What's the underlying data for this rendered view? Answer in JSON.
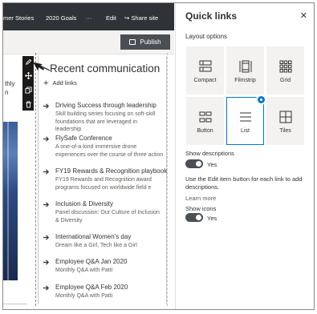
{
  "topbar": {
    "items": [
      "mer Stories",
      "2020 Goals",
      "···",
      "Edit",
      "Share site"
    ]
  },
  "command_bar": {
    "publish_label": "Publish"
  },
  "left_canvas": {
    "partial_text_line1": "thly",
    "partial_text_line2": "n"
  },
  "web_part": {
    "title": "Recent communication",
    "add_links_label": "Add links",
    "links": [
      {
        "title": "Driving Success through leadership",
        "description": "Skill building series focusing on soft-skill foundations that are leveraged in leadership"
      },
      {
        "title": "FlySafe Conference",
        "description": "A one-of-a-kind immersive drone experiences over the course of three action"
      },
      {
        "title": "FY19 Rewards & Recognition playbook",
        "description": "FY19 Rewards and Recognition award programs focused on worldwide field e"
      },
      {
        "title": "Inclusion & Diversity",
        "description": "Panel discussion: Our Culture of Inclusion & Diversity"
      },
      {
        "title": "International Women's day",
        "description": "Dream like a Girl, Tech like a Girl"
      },
      {
        "title": "Employee Q&A Jan 2020",
        "description": "Monthly Q&A with Patti"
      },
      {
        "title": "Employee Q&A Feb 2020",
        "description": "Monthly Q&A with Patti"
      }
    ]
  },
  "pane": {
    "title": "Quick links",
    "close_icon": "close-icon",
    "layout_options_label": "Layout options",
    "layouts": [
      {
        "label": "Compact",
        "icon": "compact-icon",
        "selected": false
      },
      {
        "label": "Filmstrip",
        "icon": "filmstrip-icon",
        "selected": false
      },
      {
        "label": "Grid",
        "icon": "grid-icon",
        "selected": false
      },
      {
        "label": "Button",
        "icon": "button-icon",
        "selected": false
      },
      {
        "label": "List",
        "icon": "list-icon",
        "selected": true
      },
      {
        "label": "Tiles",
        "icon": "tiles-icon",
        "selected": false
      }
    ],
    "show_descriptions_label": "Show descriptions",
    "show_descriptions_value": "Yes",
    "help_text": "Use the Edit item button for each link to add descriptions.",
    "learn_more": "Learn more",
    "show_icons_label": "Show icons",
    "show_icons_value": "Yes"
  },
  "colors": {
    "accent": "#0078d4",
    "suite_bar": "#2f3338",
    "toolbar": "#1b1a19"
  }
}
